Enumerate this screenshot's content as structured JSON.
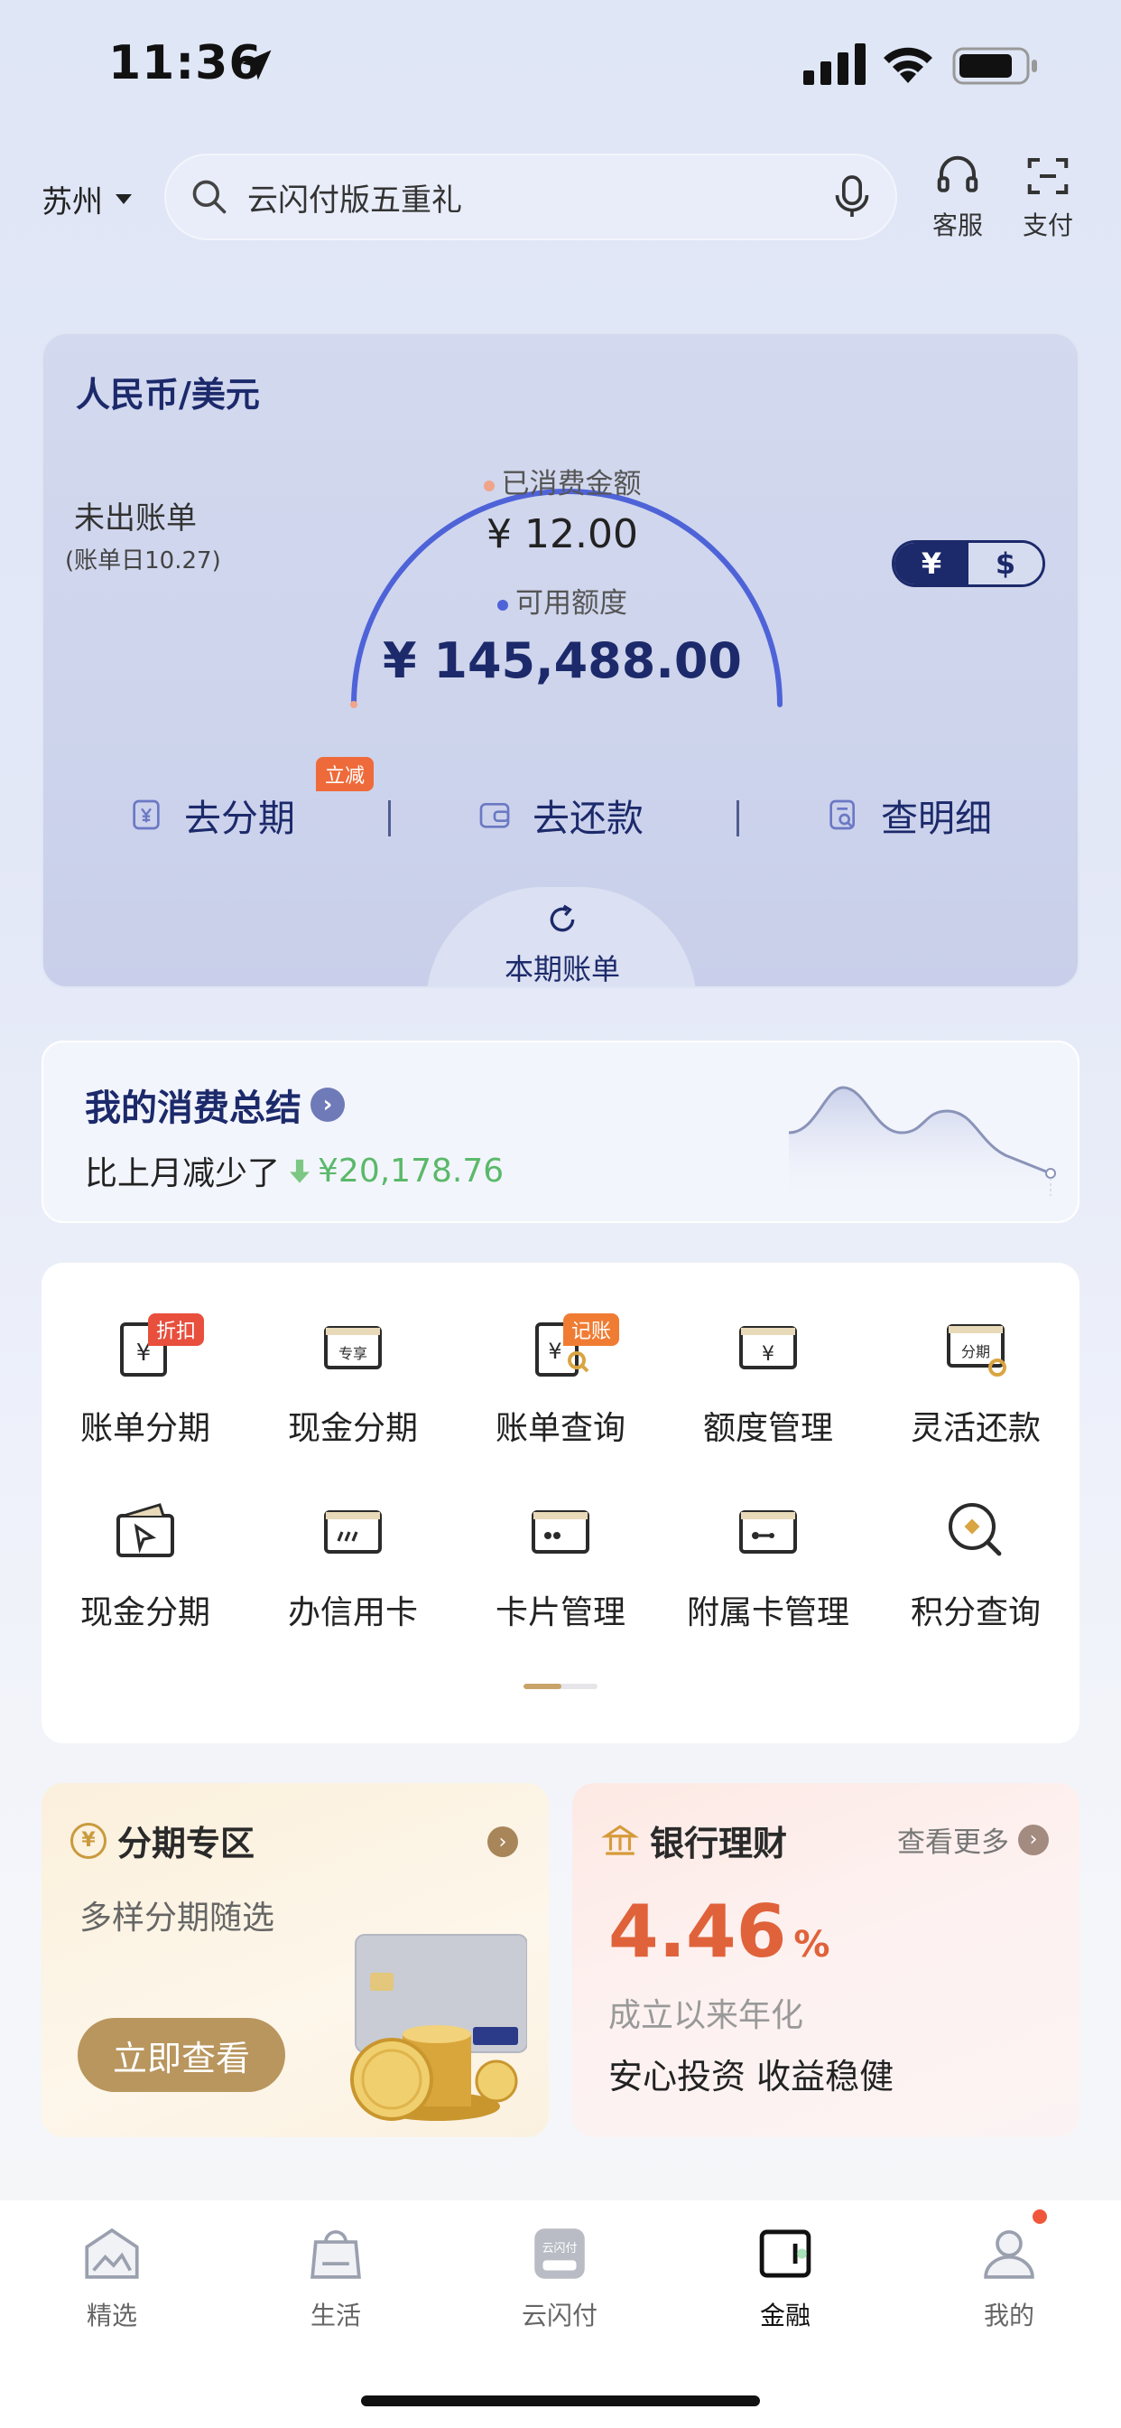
{
  "status_bar": {
    "time": "11:36"
  },
  "header": {
    "city": "苏州",
    "search_placeholder": "云闪付版五重礼",
    "service_label": "客服",
    "pay_label": "支付"
  },
  "bill_card": {
    "currency_title": "人民币/美元",
    "unbilled_label": "未出账单",
    "bill_day": "(账单日10.27)",
    "spent_label": "已消费金额",
    "spent_value": "¥ 12.00",
    "available_label": "可用额度",
    "available_value": "¥ 145,488.00",
    "currency_cny": "¥",
    "currency_usd": "$",
    "actions": [
      {
        "label": "去分期",
        "badge": "立减"
      },
      {
        "label": "去还款"
      },
      {
        "label": "查明细"
      }
    ],
    "period_tab": "本期账单",
    "colors": {
      "arc": "#4f63d8",
      "spent_dot": "#f0a48a",
      "avail_dot": "#4f63d8"
    }
  },
  "summary": {
    "title": "我的消费总结",
    "sub_text": "比上月减少了",
    "amount": "¥20,178.76"
  },
  "menu": {
    "row1": [
      {
        "label": "账单分期",
        "icon": "bill-installment-icon",
        "badge": "折扣"
      },
      {
        "label": "现金分期",
        "icon": "cash-installment-exclusive-icon",
        "badge_in_icon": "专享"
      },
      {
        "label": "账单查询",
        "icon": "bill-query-icon",
        "badge": "记账"
      },
      {
        "label": "额度管理",
        "icon": "limit-management-icon"
      },
      {
        "label": "灵活还款",
        "icon": "flexible-repayment-icon",
        "badge_in_icon": "分期"
      }
    ],
    "row2": [
      {
        "label": "现金分期",
        "icon": "wallet-cash-icon"
      },
      {
        "label": "办信用卡",
        "icon": "apply-card-icon"
      },
      {
        "label": "卡片管理",
        "icon": "card-management-icon"
      },
      {
        "label": "附属卡管理",
        "icon": "supplementary-card-icon"
      },
      {
        "label": "积分查询",
        "icon": "points-query-icon"
      }
    ]
  },
  "promo_installment": {
    "title": "分期专区",
    "subtitle": "多样分期随选",
    "button": "立即查看"
  },
  "promo_wealth": {
    "title": "银行理财",
    "more": "查看更多",
    "rate": "4.46",
    "rate_unit": "%",
    "desc": "成立以来年化",
    "slogan": "安心投资 收益稳健"
  },
  "tabbar": [
    {
      "label": "精选"
    },
    {
      "label": "生活"
    },
    {
      "label": "云闪付",
      "icon_text": "云闪付"
    },
    {
      "label": "金融",
      "active": true
    },
    {
      "label": "我的"
    }
  ]
}
